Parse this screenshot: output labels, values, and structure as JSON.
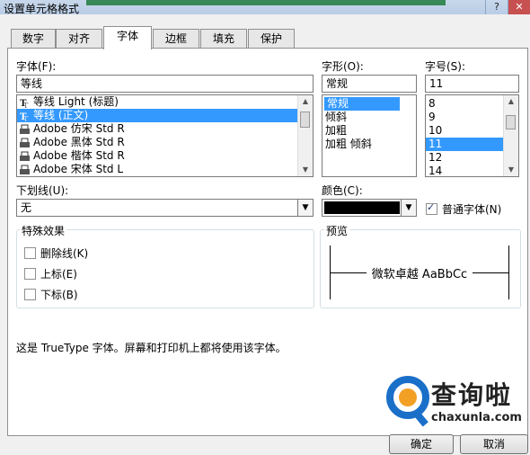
{
  "window": {
    "title": "设置单元格格式",
    "close_glyph": "✕"
  },
  "tabs": [
    {
      "label": "数字"
    },
    {
      "label": "对齐"
    },
    {
      "label": "字体"
    },
    {
      "label": "边框"
    },
    {
      "label": "填充"
    },
    {
      "label": "保护"
    }
  ],
  "active_tab": "字体",
  "font": {
    "label": "字体(F):",
    "value": "等线",
    "items": [
      {
        "icon": "truetype-icon",
        "label": "等线 Light (标题)"
      },
      {
        "icon": "truetype-icon",
        "label": "等线 (正文)"
      },
      {
        "icon": "printer-font-icon",
        "label": "Adobe 仿宋 Std R"
      },
      {
        "icon": "printer-font-icon",
        "label": "Adobe 黑体 Std R"
      },
      {
        "icon": "printer-font-icon",
        "label": "Adobe 楷体 Std R"
      },
      {
        "icon": "printer-font-icon",
        "label": "Adobe 宋体 Std L"
      }
    ],
    "selected_index": 1
  },
  "style": {
    "label": "字形(O):",
    "value": "常规",
    "items": [
      "常规",
      "倾斜",
      "加粗",
      "加粗 倾斜"
    ],
    "selected_index": 0
  },
  "size": {
    "label": "字号(S):",
    "value": "11",
    "items": [
      "8",
      "9",
      "10",
      "11",
      "12",
      "14"
    ],
    "selected_index": 3
  },
  "underline": {
    "label": "下划线(U):",
    "value": "无"
  },
  "color": {
    "label": "颜色(C):",
    "value": "#000000"
  },
  "normal_font": {
    "label": "普通字体(N)",
    "checked": true
  },
  "effects": {
    "title": "特殊效果",
    "items": [
      {
        "label": "删除线(K)",
        "checked": false
      },
      {
        "label": "上标(E)",
        "checked": false
      },
      {
        "label": "下标(B)",
        "checked": false
      }
    ]
  },
  "preview": {
    "title": "预览",
    "text": "微软卓越  AaBbCc"
  },
  "info_text": "这是 TrueType 字体。屏幕和打印机上都将使用该字体。",
  "buttons": {
    "ok": "确定",
    "cancel": "取消"
  },
  "watermark": {
    "brand": "查询啦",
    "site": "chaxunla.com",
    "colors": {
      "blue": "#1a6fc9",
      "orange": "#f2a024",
      "dark": "#222222"
    }
  }
}
